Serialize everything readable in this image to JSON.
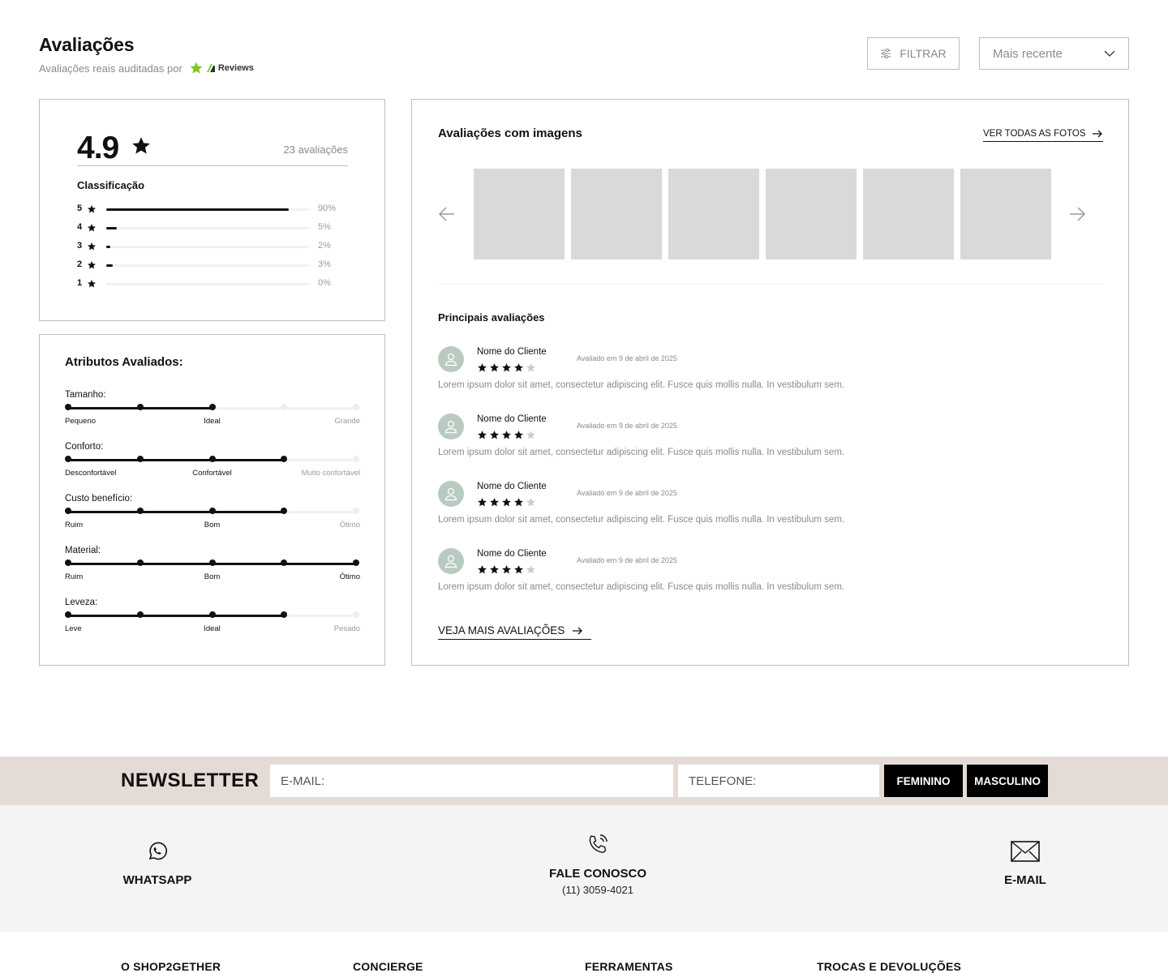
{
  "header": {
    "title": "Avaliações",
    "subtitle": "Avaliações reais auditadas por",
    "provider_logo": "Reviews",
    "filter_label": "FILTRAR",
    "sort_value": "Mais recente"
  },
  "summary": {
    "score": "4.9",
    "count": "23 avaliações",
    "classification_title": "Classificação",
    "distribution": [
      {
        "stars": "5",
        "percent": 90,
        "label": "90%"
      },
      {
        "stars": "4",
        "percent": 5,
        "label": "5%"
      },
      {
        "stars": "3",
        "percent": 2,
        "label": "2%"
      },
      {
        "stars": "2",
        "percent": 3,
        "label": "3%"
      },
      {
        "stars": "1",
        "percent": 0,
        "label": "0%"
      }
    ]
  },
  "attributes": {
    "title": "Atributos Avaliados:",
    "items": [
      {
        "name": "Tamanho:",
        "level": 3,
        "steps": 5,
        "labels": [
          "Pequeno",
          "Ideal",
          "Grande"
        ]
      },
      {
        "name": "Conforto:",
        "level": 4,
        "steps": 5,
        "labels": [
          "Desconfortável",
          "Confortável",
          "Muito confortável"
        ]
      },
      {
        "name": "Custo benefício:",
        "level": 4,
        "steps": 5,
        "labels": [
          "Ruim",
          "Bom",
          "Ótimo"
        ]
      },
      {
        "name": "Material:",
        "level": 5,
        "steps": 5,
        "labels": [
          "Ruim",
          "Bom",
          "Ótimo"
        ]
      },
      {
        "name": "Leveza:",
        "level": 4,
        "steps": 5,
        "labels": [
          "Leve",
          "Ideal",
          "Pesado"
        ]
      }
    ]
  },
  "images": {
    "title": "Avaliações com imagens",
    "see_all": "VER TODAS AS FOTOS",
    "thumb_count": 6
  },
  "reviews": {
    "title": "Principais avaliações",
    "items": [
      {
        "name": "Nome do Cliente",
        "rating": 4,
        "date": "Avaliado em 9 de abril de 2025",
        "text": "Lorem ipsum dolor sit amet, consectetur adipiscing elit. Fusce quis mollis nulla. In vestibulum sem."
      },
      {
        "name": "Nome do Cliente",
        "rating": 4,
        "date": "Avaliado em 9 de abril de 2025",
        "text": "Lorem ipsum dolor sit amet, consectetur adipiscing elit. Fusce quis mollis nulla. In vestibulum sem."
      },
      {
        "name": "Nome do Cliente",
        "rating": 4,
        "date": "Avaliado em 9 de abril de 2025",
        "text": "Lorem ipsum dolor sit amet, consectetur adipiscing elit. Fusce quis mollis nulla. In vestibulum sem."
      },
      {
        "name": "Nome do Cliente",
        "rating": 4,
        "date": "Avaliado em 9 de abril de 2025",
        "text": "Lorem ipsum dolor sit amet, consectetur adipiscing elit. Fusce quis mollis nulla. In vestibulum sem."
      }
    ],
    "more_link": "VEJA MAIS AVALIAÇÕES"
  },
  "newsletter": {
    "title": "NEWSLETTER",
    "email_placeholder": "E-MAIL:",
    "phone_placeholder": "TELEFONE:",
    "btn_female": "FEMININO",
    "btn_male": "MASCULINO"
  },
  "contact": {
    "whatsapp": "WHATSAPP",
    "fale_conosco": "FALE CONOSCO",
    "phone": "(11) 3059-4021",
    "email": "E-MAIL"
  },
  "footer": {
    "columns": [
      "O SHOP2GETHER",
      "CONCIERGE",
      "FERRAMENTAS",
      "TROCAS E DEVOLUÇÕES"
    ]
  },
  "colors": {
    "newsletter_bg": "#e5dbd6",
    "contact_bg": "#f4f4f4",
    "thumb": "#d9d9d9",
    "avatar": "#b9cbc1",
    "accent_logo": "#7cc624"
  }
}
